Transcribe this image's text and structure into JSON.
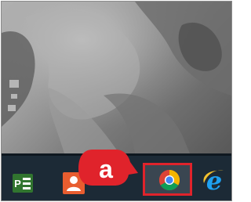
{
  "callout": {
    "label": "a",
    "color": "#e0232b"
  },
  "taskbar": {
    "background": "#1c2a36",
    "apps": [
      {
        "icon": "microsoft-project-icon",
        "text": "P",
        "color": "#31752f"
      },
      {
        "icon": "people-icon",
        "color": "#e85d2f"
      },
      {
        "icon": "chrome-icon",
        "highlighted": true,
        "highlight_color": "#e0232b"
      },
      {
        "icon": "internet-explorer-icon",
        "color": "#1ea1f1"
      }
    ]
  }
}
